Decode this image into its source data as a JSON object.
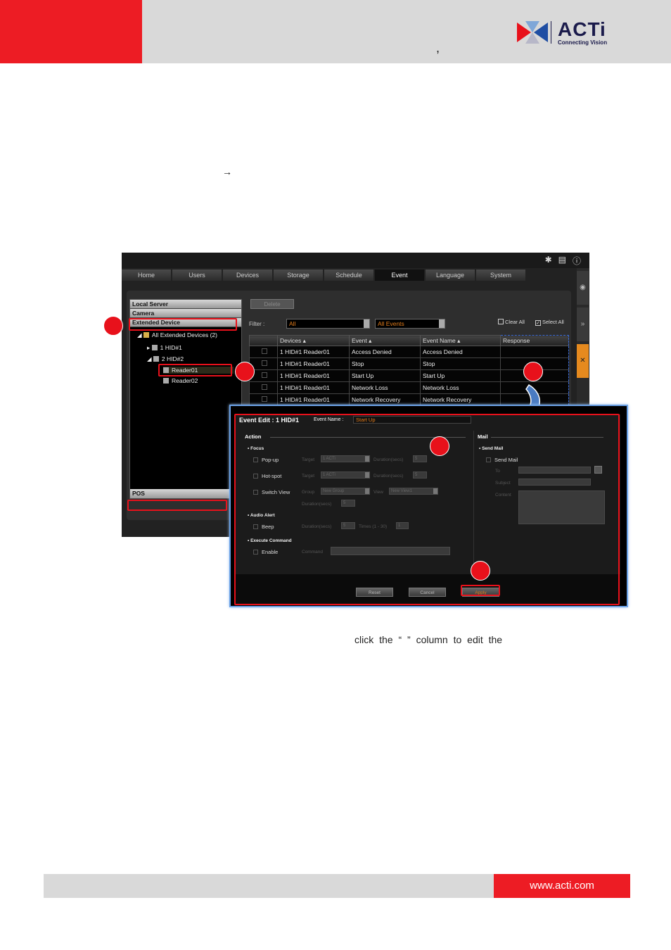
{
  "header": {
    "comma": ",",
    "logo_word": "ACTi",
    "logo_tagline": "Connecting Vision"
  },
  "arrow_glyph": "→",
  "app": {
    "top_icons": [
      "gear-icon",
      "document-icon",
      "info-icon"
    ],
    "tabs": [
      "Home",
      "Users",
      "Devices",
      "Storage",
      "Schedule",
      "Event",
      "Language",
      "System"
    ],
    "active_tab": "Event",
    "side_icons": [
      "eye-icon",
      "fast-forward-icon",
      "tools-icon"
    ],
    "left_panel": {
      "headers": [
        "Local Server",
        "Camera",
        "Extended Device"
      ],
      "tree": {
        "root": "All Extended Devices (2)",
        "hid1": "1 HID#1",
        "hid2": "2 HID#2",
        "reader1": "Reader01",
        "reader2": "Reader02"
      },
      "pos": "POS"
    },
    "toolbar": {
      "delete_label": "Delete",
      "filter_label": "Filter :",
      "filter_devices": "All",
      "filter_events": "All Events",
      "clear_all": "Clear All",
      "select_all": "Select All"
    },
    "table": {
      "columns": [
        "Devices",
        "Event",
        "Event Name",
        "Response"
      ],
      "rows": [
        [
          "1 HID#1 Reader01",
          "Access Denied",
          "Access Denied"
        ],
        [
          "1 HID#1 Reader01",
          "Stop",
          "Stop"
        ],
        [
          "1 HID#1 Reader01",
          "Start Up",
          "Start Up"
        ],
        [
          "1 HID#1 Reader01",
          "Network Loss",
          "Network Loss"
        ],
        [
          "1 HID#1 Reader01",
          "Network Recovery",
          "Network Recovery"
        ]
      ]
    }
  },
  "dialog": {
    "title": "Event Edit : 1 HID#1",
    "event_name_label": "Event Name :",
    "event_name_value": "Start Up",
    "action_label": "Action",
    "mail_label": "Mail",
    "focus_label": "Focus",
    "popup_label": "Pop-up",
    "hotspot_label": "Hot-spot",
    "switchview_label": "Switch View",
    "target_label": "Target",
    "target_value": "1 ACTi",
    "duration_label": "Duration(secs)",
    "duration_value": "5",
    "group_label": "Group",
    "group_value": "New Group",
    "view_label": "View",
    "view_value": "New View1",
    "audio_alert_label": "Audio Alert",
    "beep_label": "Beep",
    "times_label": "Times (1 - 30)",
    "times_value": "1",
    "execute_label": "Execute Command",
    "enable_label": "Enable",
    "command_label": "Command",
    "send_mail_sub": "Send Mail",
    "send_mail_opt": "Send Mail",
    "to_label": "To",
    "subject_label": "Subject",
    "content_label": "Content",
    "reset_label": "Reset",
    "cancel_label": "Cancel",
    "apply_label": "Apply"
  },
  "body_text": "click the “ ” column to edit the",
  "footer_url": "www.acti.com"
}
